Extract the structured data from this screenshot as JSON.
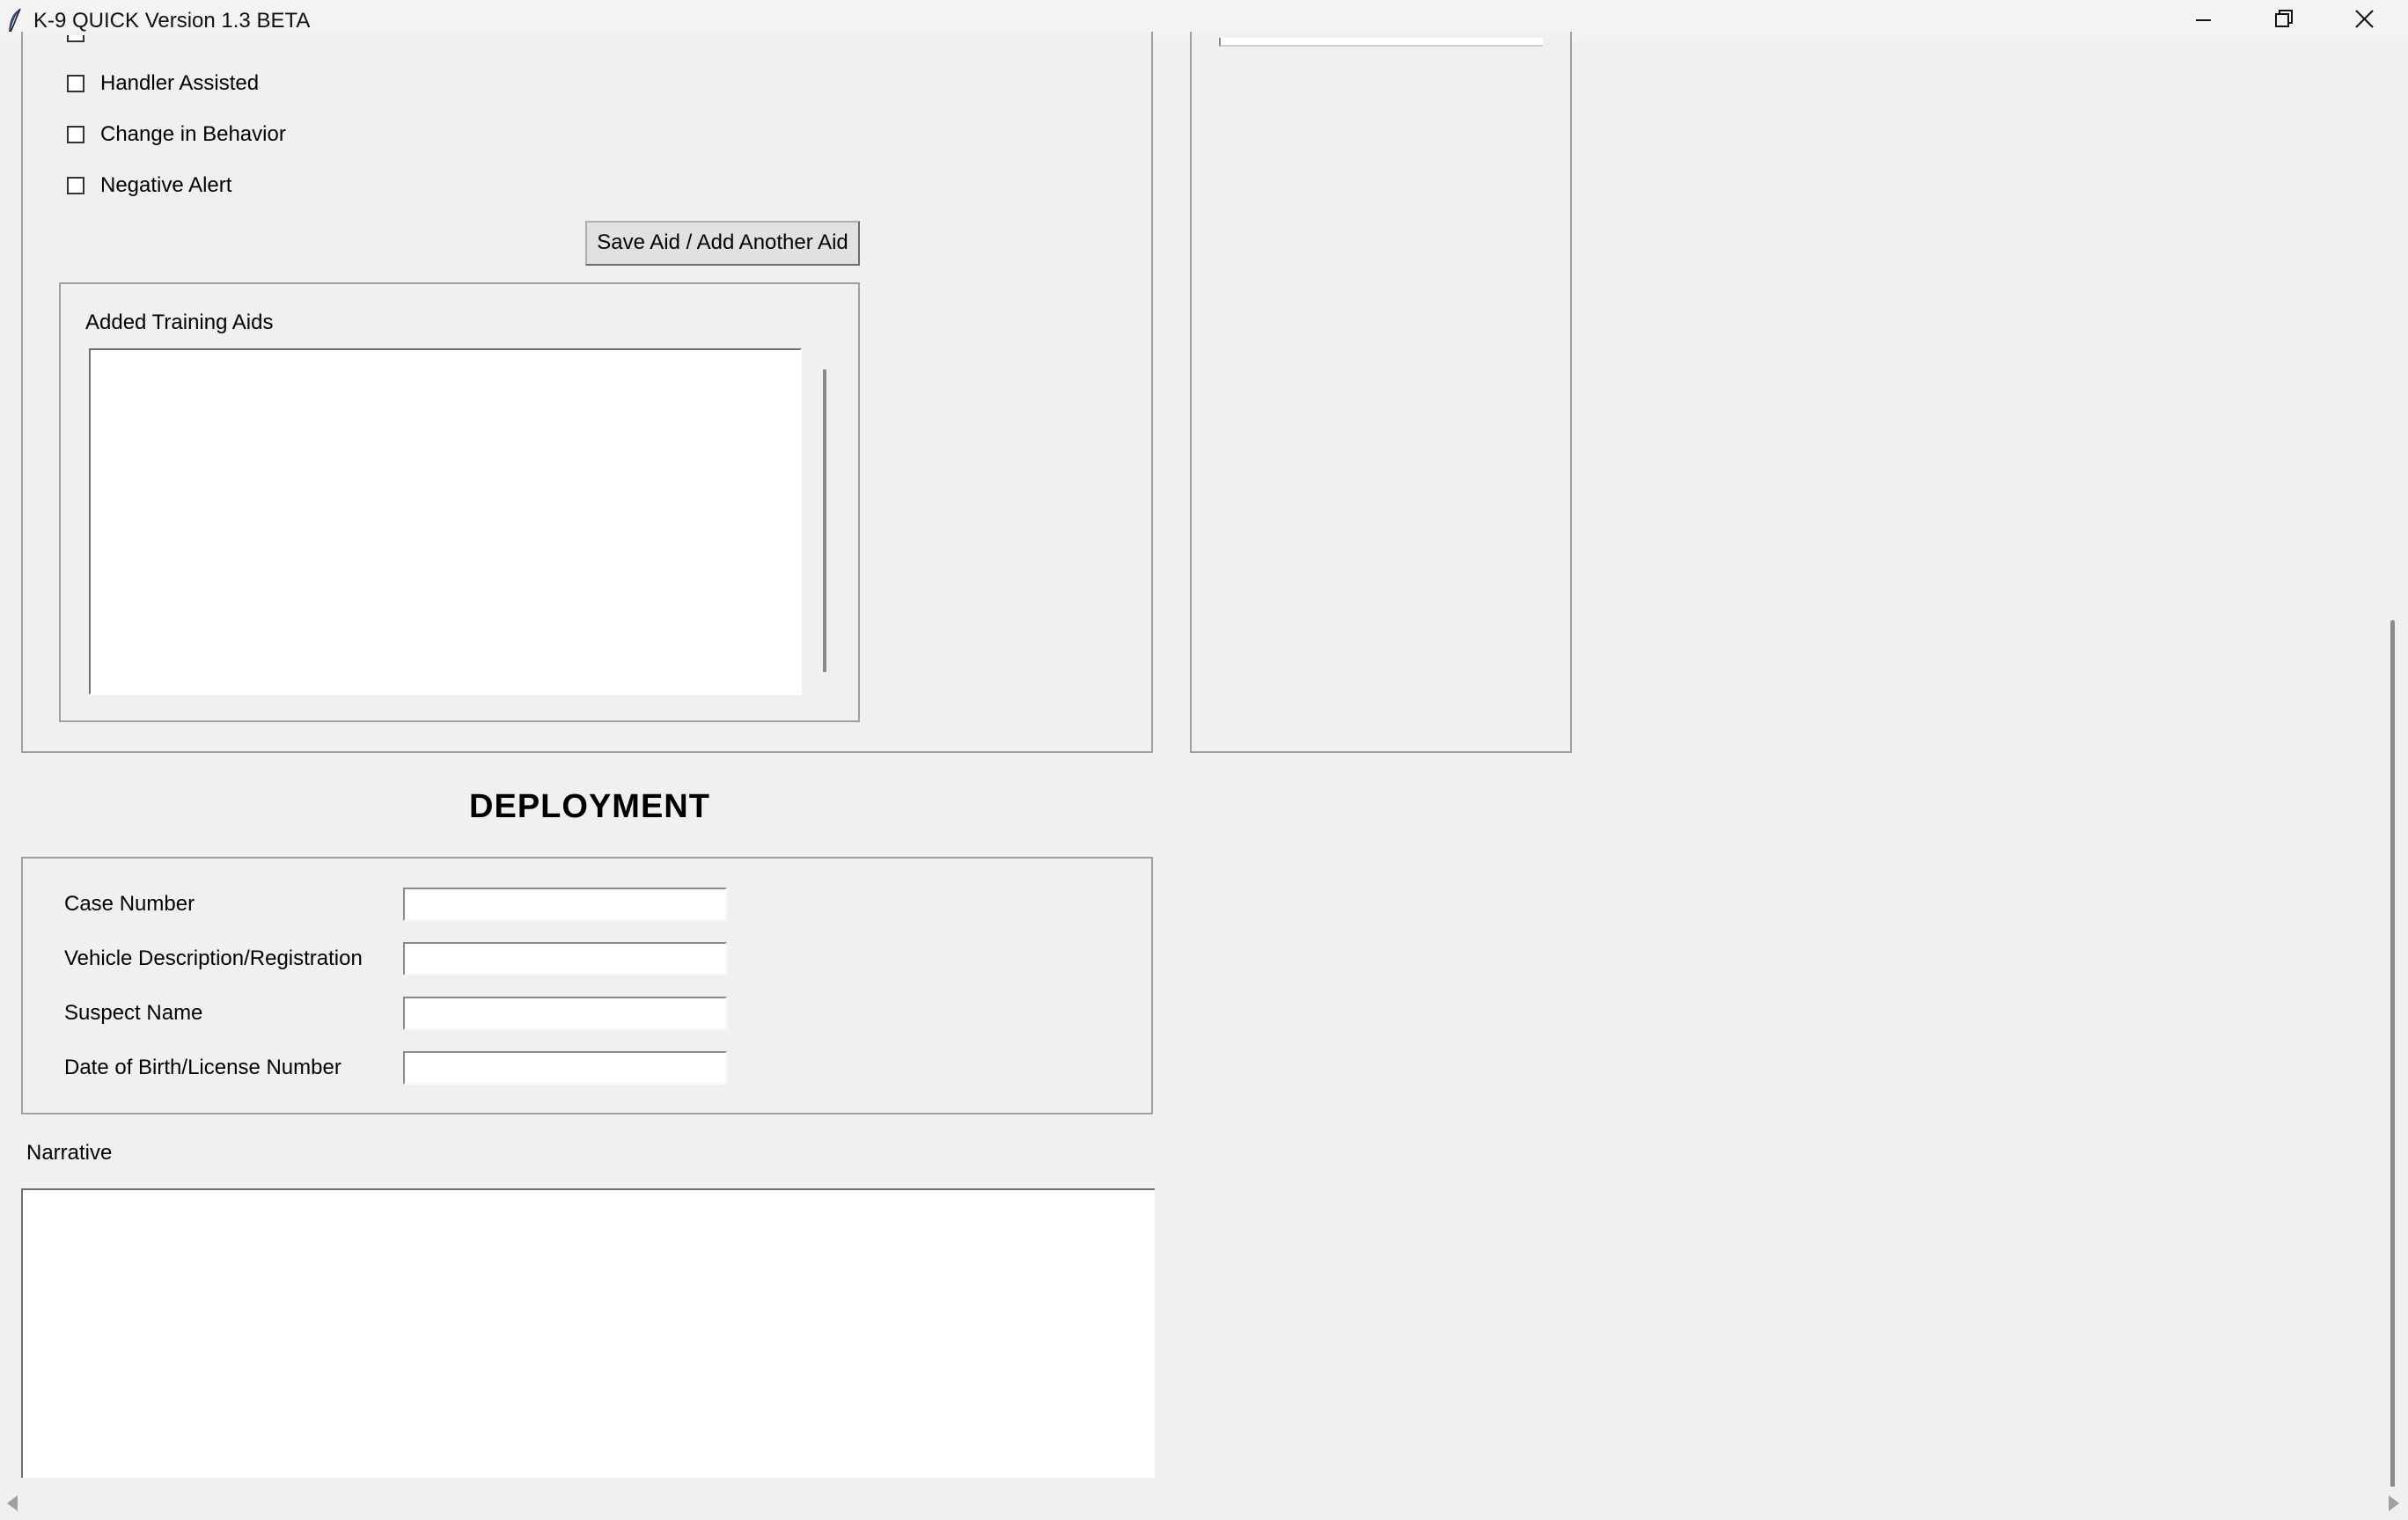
{
  "window": {
    "title": "K-9 QUICK Version 1.3 BETA"
  },
  "training_aid": {
    "checkboxes": [
      {
        "label": "Handler Assisted",
        "checked": false
      },
      {
        "label": "Change in Behavior",
        "checked": false
      },
      {
        "label": "Negative Alert",
        "checked": false
      }
    ],
    "save_button_label": "Save Aid / Add Another Aid",
    "added_aids_label": "Added Training Aids",
    "added_aids_items": []
  },
  "deployment": {
    "heading": "DEPLOYMENT",
    "fields": [
      {
        "label": "Case Number",
        "value": ""
      },
      {
        "label": "Vehicle Description/Registration",
        "value": ""
      },
      {
        "label": "Suspect Name",
        "value": ""
      },
      {
        "label": "Date of Birth/License Number",
        "value": ""
      }
    ],
    "narrative_label": "Narrative",
    "narrative_value": ""
  },
  "icons": {
    "app": "feather-icon",
    "minimize": "minimize-icon",
    "restore": "restore-icon",
    "close": "close-icon",
    "scroll_left": "arrow-left-icon",
    "scroll_right": "arrow-right-icon"
  }
}
